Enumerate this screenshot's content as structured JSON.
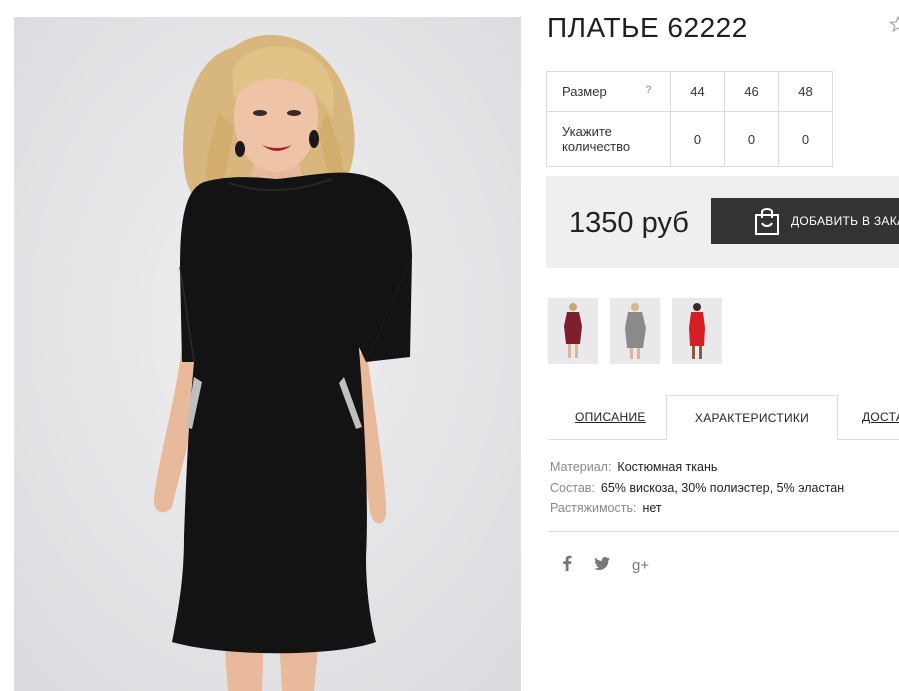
{
  "product": {
    "title": "ПЛАТЬЕ 62222",
    "favorite_icon": "star-icon"
  },
  "sizes": {
    "size_label": "Размер",
    "help": "?",
    "values": [
      "44",
      "46",
      "48"
    ],
    "qty_label_line1": "Укажите",
    "qty_label_line2": "количество",
    "quantities": [
      "0",
      "0",
      "0"
    ]
  },
  "buy": {
    "price": "1350 руб",
    "add_label": "ДОБАВИТЬ В ЗАКАЗ",
    "bag_icon": "shopping-bag-icon"
  },
  "thumbnails": [
    {
      "color": "#7d1f2e"
    },
    {
      "color": "#8a8a8a"
    },
    {
      "color": "#d41f25"
    }
  ],
  "tabs": [
    "ОПИСАНИЕ",
    "ХАРАКТЕРИСТИКИ",
    "ДОСТАВКА"
  ],
  "specs": [
    {
      "key": "Материал:",
      "value": "Костюмная ткань"
    },
    {
      "key": "Состав:",
      "value": "65% вискоза, 30% полиэстер, 5% эластан"
    },
    {
      "key": "Растяжимость:",
      "value": "нет"
    }
  ],
  "social": {
    "facebook": "f",
    "twitter": "🐦",
    "googleplus": "g+"
  },
  "colors": {
    "button": "#333333",
    "buybox": "#efefef",
    "dress": "#131313"
  }
}
